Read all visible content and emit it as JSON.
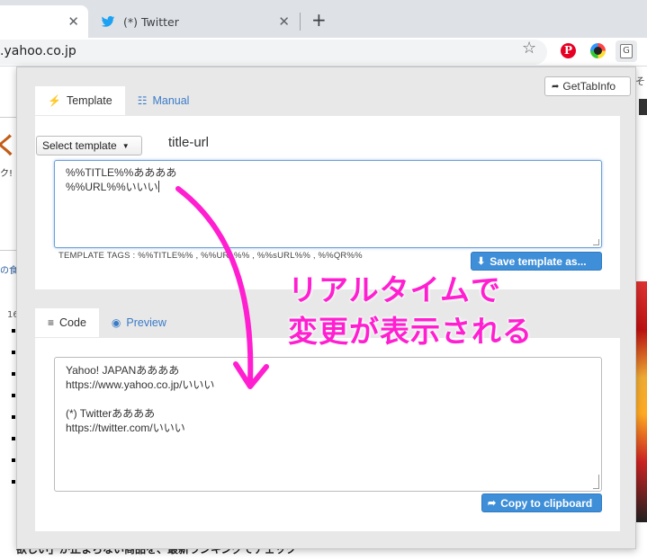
{
  "browser": {
    "tabs": [
      {
        "label": ""
      },
      {
        "label": "(*) Twitter"
      }
    ],
    "url": ".yahoo.co.jp"
  },
  "page_bg": {
    "left_snippet_1": "ク!",
    "left_snippet_2": "の食",
    "list_number": "16",
    "bottom_text": "欲しい」が止まらない商品を、最新ランキングでチェック",
    "right_snippet": "そ"
  },
  "popup": {
    "gettab_label": "GetTabInfo",
    "template_tabs": [
      {
        "label": "Template",
        "icon": "bolt-icon"
      },
      {
        "label": "Manual",
        "icon": "list-icon"
      }
    ],
    "select_template_label": "Select template",
    "template_name": "title-url",
    "template_lines": [
      "%%TITLE%%ああああ",
      "%%URL%%いいい"
    ],
    "template_tags": "TEMPLATE TAGS : %%TITLE%% , %%URL%% , %%sURL%% , %%QR%%",
    "save_template_label": "Save template as...",
    "output_tabs": [
      {
        "label": "Code",
        "icon": "list-lines-icon"
      },
      {
        "label": "Preview",
        "icon": "eye-icon"
      }
    ],
    "output_lines": [
      "Yahoo! JAPANああああ",
      "https://www.yahoo.co.jp/いいい",
      "",
      "(*) Twitterああああ",
      "https://twitter.com/いいい"
    ],
    "copy_label": "Copy to clipboard"
  },
  "annotation": {
    "line1": "リアルタイムで",
    "line2": "変更が表示される",
    "color": "#ff1fd0"
  }
}
